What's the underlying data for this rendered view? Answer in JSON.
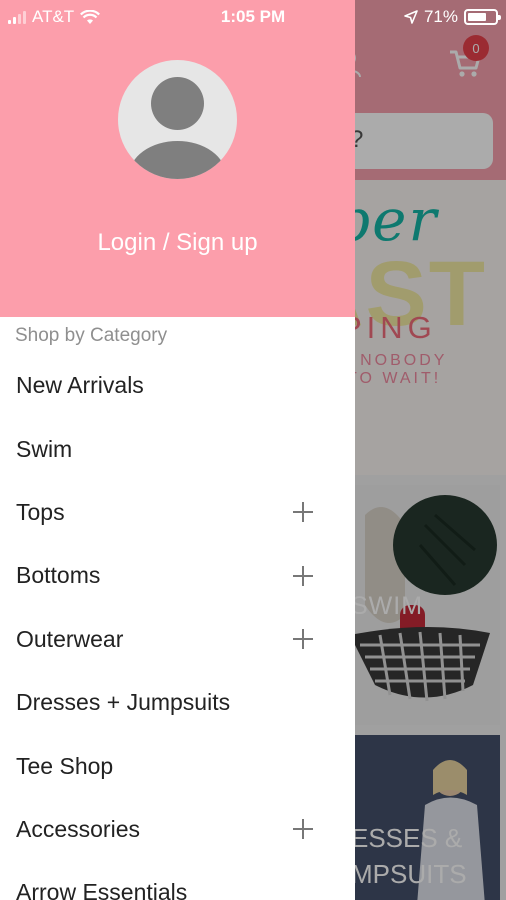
{
  "status_bar": {
    "carrier": "AT&T",
    "time": "1:05 PM",
    "battery_percent": "71%",
    "battery_level": 0.71,
    "icons": [
      "signal-icon",
      "wifi-icon",
      "location-arrow-icon",
      "battery-icon"
    ]
  },
  "drawer": {
    "avatar_icon": "user-placeholder-icon",
    "login_label": "Login / Sign up",
    "section_title": "Shop by Category",
    "items": [
      {
        "label": "New Arrivals",
        "expandable": false
      },
      {
        "label": "Swim",
        "expandable": false
      },
      {
        "label": "Tops",
        "expandable": true
      },
      {
        "label": "Bottoms",
        "expandable": true
      },
      {
        "label": "Outerwear",
        "expandable": true
      },
      {
        "label": "Dresses + Jumpsuits",
        "expandable": false
      },
      {
        "label": "Tee Shop",
        "expandable": false
      },
      {
        "label": "Accessories",
        "expandable": true
      },
      {
        "label": "Arrow Essentials",
        "expandable": false
      }
    ]
  },
  "background": {
    "cart_count": "0",
    "search_partial": "?",
    "banner1": {
      "line1": "per",
      "line2": "AST",
      "line3": "PING",
      "line4": "E NOBODY",
      "line5": "TO WAIT!"
    },
    "banner2_label": "SWIM",
    "banner3": {
      "line1": "ESSES &",
      "line2": "MPSUITS"
    }
  },
  "colors": {
    "header_pink": "#fc9eab",
    "badge_red": "#e8414b",
    "teal": "#16b5a6"
  }
}
